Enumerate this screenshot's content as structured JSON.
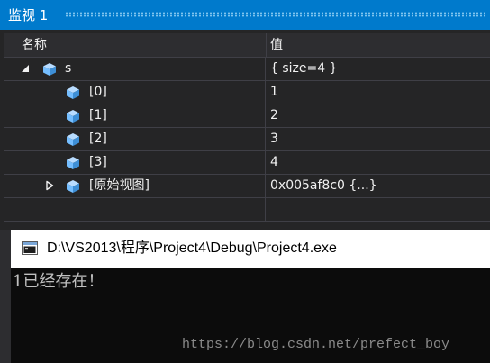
{
  "watch_window": {
    "title": "监视 1",
    "columns": {
      "name": "名称",
      "value": "值"
    },
    "rows": [
      {
        "name": "s",
        "value": "{ size=4 }",
        "expander": "expanded",
        "icon": "object-cube-icon"
      },
      {
        "name": "[0]",
        "value": "1",
        "expander": "none",
        "icon": "object-cube-icon"
      },
      {
        "name": "[1]",
        "value": "2",
        "expander": "none",
        "icon": "object-cube-icon"
      },
      {
        "name": "[2]",
        "value": "3",
        "expander": "none",
        "icon": "object-cube-icon"
      },
      {
        "name": "[3]",
        "value": "4",
        "expander": "none",
        "icon": "object-cube-icon"
      },
      {
        "name": "[原始视图]",
        "value": "0x005af8c0 {...}",
        "expander": "collapsed",
        "icon": "object-cube-icon"
      }
    ]
  },
  "console_window": {
    "title": "D:\\VS2013\\程序\\Project4\\Debug\\Project4.exe",
    "output": "1已经存在！",
    "watermark": "https://blog.csdn.net/prefect_boy"
  },
  "colors": {
    "accent": "#007acc",
    "panel_bg": "#252526",
    "grid_line": "#3f3f46",
    "text": "#f1f1f1",
    "console_bg": "#0c0c0c",
    "console_text": "#c0c0c0",
    "cube_icon": "#75beff"
  }
}
